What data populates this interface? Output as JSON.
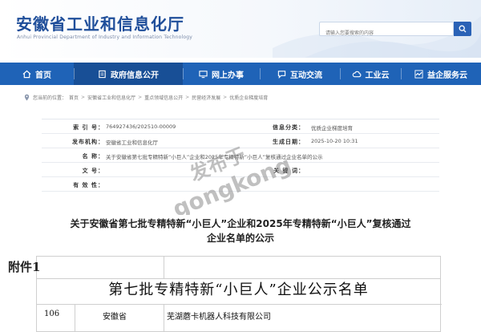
{
  "header": {
    "site_title": "安徽省工业和信息化厅",
    "site_subtitle": "Anhui Provincial Department of Industry and Information Technology",
    "search_placeholder": "请输入您要搜索的内容"
  },
  "nav": {
    "items": [
      {
        "label": "首页",
        "icon": "home-icon"
      },
      {
        "label": "政府信息公开",
        "icon": "info-public-icon",
        "active": true
      },
      {
        "label": "网上办事",
        "icon": "monitor-icon"
      },
      {
        "label": "互动交流",
        "icon": "chat-icon"
      },
      {
        "label": "工业云",
        "icon": "cloud-icon"
      },
      {
        "label": "益企服务云",
        "icon": "service-icon"
      }
    ]
  },
  "breadcrumb": {
    "prefix": "您当前的位置：",
    "items": [
      "首页",
      "安徽省工业和信息化厅",
      "重点领域信息公开",
      "民营经济发展",
      "优质企业梯度培育"
    ]
  },
  "info": {
    "index_label": "索 引 号：",
    "index_value": "764927436/202510-00009",
    "category_label": "信息分类：",
    "category_value": "优质企业梯度培育",
    "issuer_label": "发布机构：",
    "issuer_value": "安徽省工业和信息化厅",
    "date_label": "生成日期：",
    "date_value": "2025-10-20 10:31",
    "name_label": "名    称：",
    "name_value": "关于安徽省第七批专精特新“小巨人”企业和2025年专精特新“小巨人”复核通过企业名单的公示",
    "docno_label": "文    号：",
    "keyword_label": "关 键 词：",
    "validity_label": "有 效 性："
  },
  "watermark": {
    "line1": "发布于",
    "line2": "gongkong"
  },
  "article": {
    "title_line1": "关于安徽省第七批专精特新“小巨人”企业和2025年专精特新“小巨人”复核通过",
    "title_line2": "企业名单的公示"
  },
  "attachment": {
    "label": "附件1",
    "heading": "第七批专精特新“小巨人”企业公示名单",
    "row": {
      "no": "106",
      "province": "安徽省",
      "company": "芜湖蘑卡机器人科技有限公司"
    }
  },
  "colors": {
    "brand": "#1f4e9a",
    "nav": "#1f63b7",
    "nav_active": "#184f96"
  }
}
